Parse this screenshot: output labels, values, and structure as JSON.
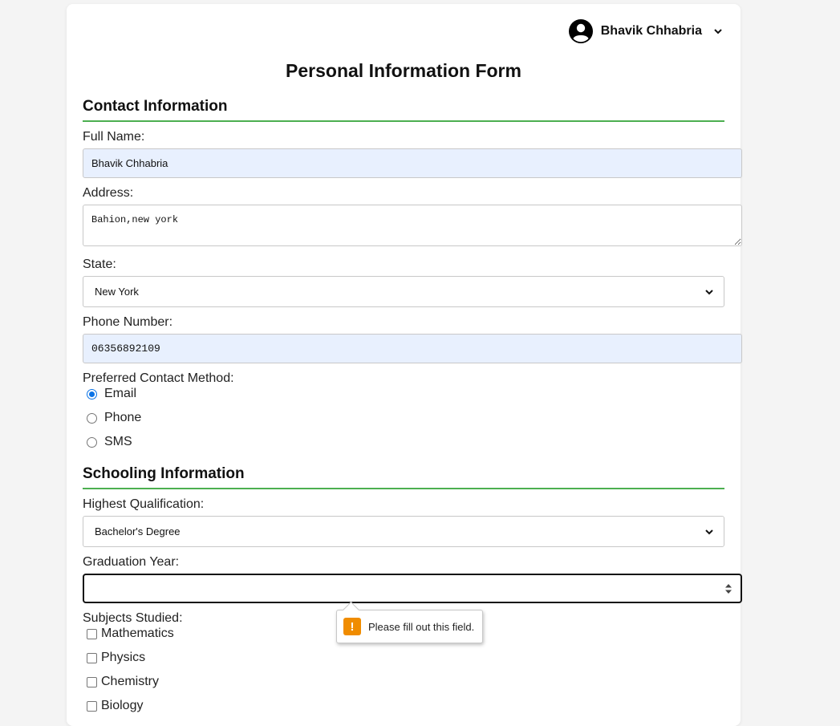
{
  "user": {
    "name": "Bhavik Chhabria"
  },
  "page": {
    "title": "Personal Information Form"
  },
  "contact": {
    "section_title": "Contact Information",
    "full_name_label": "Full Name:",
    "full_name_value": "Bhavik Chhabria",
    "address_label": "Address:",
    "address_value": "Bahion,new york",
    "state_label": "State:",
    "state_value": "New York",
    "phone_label": "Phone Number:",
    "phone_value": "06356892109",
    "method_label": "Preferred Contact Method:",
    "methods": [
      {
        "label": "Email",
        "checked": true
      },
      {
        "label": "Phone",
        "checked": false
      },
      {
        "label": "SMS",
        "checked": false
      }
    ]
  },
  "schooling": {
    "section_title": "Schooling Information",
    "qualification_label": "Highest Qualification:",
    "qualification_value": "Bachelor's Degree",
    "graduation_label": "Graduation Year:",
    "graduation_value": "",
    "subjects_label": "Subjects Studied:",
    "subjects": [
      {
        "label": "Mathematics",
        "checked": false
      },
      {
        "label": "Physics",
        "checked": false
      },
      {
        "label": "Chemistry",
        "checked": false
      },
      {
        "label": "Biology",
        "checked": false
      }
    ]
  },
  "validation": {
    "message": "Please fill out this field.",
    "icon": "warning-icon"
  },
  "colors": {
    "accent_line": "#4caf50",
    "radio_checked": "#0b73e6",
    "warning": "#f08c00",
    "autofill_bg": "#e8f0fe"
  }
}
